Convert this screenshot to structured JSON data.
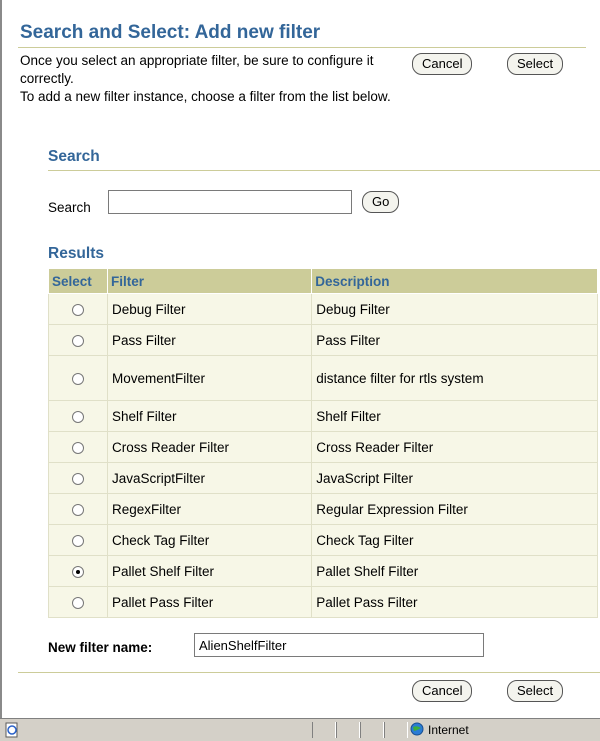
{
  "page": {
    "title": "Search and Select: Add new filter",
    "intro_line1": "Once you select an appropriate filter, be sure to configure it correctly.",
    "intro_line2": "To add a new filter instance, choose a filter from the list below.",
    "cancel_label": "Cancel",
    "select_label": "Select"
  },
  "search": {
    "heading": "Search",
    "label": "Search",
    "value": "",
    "go_label": "Go"
  },
  "results": {
    "heading": "Results",
    "columns": [
      "Select",
      "Filter",
      "Description"
    ],
    "rows": [
      {
        "filter": "Debug Filter",
        "description": "Debug Filter",
        "selected": false
      },
      {
        "filter": "Pass Filter",
        "description": "Pass Filter",
        "selected": false
      },
      {
        "filter": "MovementFilter",
        "description": "distance filter for rtls system",
        "selected": false
      },
      {
        "filter": "Shelf Filter",
        "description": "Shelf Filter",
        "selected": false
      },
      {
        "filter": "Cross Reader Filter",
        "description": "Cross Reader Filter",
        "selected": false
      },
      {
        "filter": "JavaScriptFilter",
        "description": "JavaScript Filter",
        "selected": false
      },
      {
        "filter": "RegexFilter",
        "description": "Regular Expression Filter",
        "selected": false
      },
      {
        "filter": "Check Tag Filter",
        "description": "Check Tag Filter",
        "selected": false
      },
      {
        "filter": "Pallet Shelf Filter",
        "description": "Pallet Shelf Filter",
        "selected": true
      },
      {
        "filter": "Pallet Pass Filter",
        "description": "Pallet Pass Filter",
        "selected": false
      }
    ]
  },
  "new_filter": {
    "label": "New filter name:",
    "value": "AlienShelfFilter"
  },
  "statusbar": {
    "zone": "Internet",
    "icon": "ie-page-icon",
    "zone_icon": "globe-icon"
  },
  "colors": {
    "heading": "#336699",
    "header_bg": "#cccc99",
    "row_bg": "#f7f7e7"
  }
}
